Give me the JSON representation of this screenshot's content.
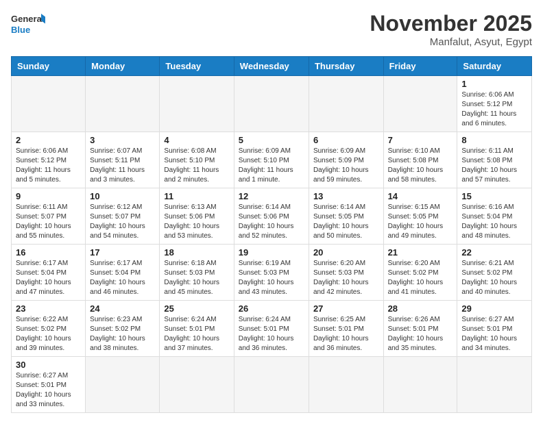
{
  "header": {
    "logo_general": "General",
    "logo_blue": "Blue",
    "month_year": "November 2025",
    "location": "Manfalut, Asyut, Egypt"
  },
  "weekdays": [
    "Sunday",
    "Monday",
    "Tuesday",
    "Wednesday",
    "Thursday",
    "Friday",
    "Saturday"
  ],
  "days": {
    "d1": {
      "num": "1",
      "sunrise": "6:06 AM",
      "sunset": "5:12 PM",
      "daylight": "11 hours and 6 minutes."
    },
    "d2": {
      "num": "2",
      "sunrise": "6:06 AM",
      "sunset": "5:12 PM",
      "daylight": "11 hours and 5 minutes."
    },
    "d3": {
      "num": "3",
      "sunrise": "6:07 AM",
      "sunset": "5:11 PM",
      "daylight": "11 hours and 3 minutes."
    },
    "d4": {
      "num": "4",
      "sunrise": "6:08 AM",
      "sunset": "5:10 PM",
      "daylight": "11 hours and 2 minutes."
    },
    "d5": {
      "num": "5",
      "sunrise": "6:09 AM",
      "sunset": "5:10 PM",
      "daylight": "11 hours and 1 minute."
    },
    "d6": {
      "num": "6",
      "sunrise": "6:09 AM",
      "sunset": "5:09 PM",
      "daylight": "10 hours and 59 minutes."
    },
    "d7": {
      "num": "7",
      "sunrise": "6:10 AM",
      "sunset": "5:08 PM",
      "daylight": "10 hours and 58 minutes."
    },
    "d8": {
      "num": "8",
      "sunrise": "6:11 AM",
      "sunset": "5:08 PM",
      "daylight": "10 hours and 57 minutes."
    },
    "d9": {
      "num": "9",
      "sunrise": "6:11 AM",
      "sunset": "5:07 PM",
      "daylight": "10 hours and 55 minutes."
    },
    "d10": {
      "num": "10",
      "sunrise": "6:12 AM",
      "sunset": "5:07 PM",
      "daylight": "10 hours and 54 minutes."
    },
    "d11": {
      "num": "11",
      "sunrise": "6:13 AM",
      "sunset": "5:06 PM",
      "daylight": "10 hours and 53 minutes."
    },
    "d12": {
      "num": "12",
      "sunrise": "6:14 AM",
      "sunset": "5:06 PM",
      "daylight": "10 hours and 52 minutes."
    },
    "d13": {
      "num": "13",
      "sunrise": "6:14 AM",
      "sunset": "5:05 PM",
      "daylight": "10 hours and 50 minutes."
    },
    "d14": {
      "num": "14",
      "sunrise": "6:15 AM",
      "sunset": "5:05 PM",
      "daylight": "10 hours and 49 minutes."
    },
    "d15": {
      "num": "15",
      "sunrise": "6:16 AM",
      "sunset": "5:04 PM",
      "daylight": "10 hours and 48 minutes."
    },
    "d16": {
      "num": "16",
      "sunrise": "6:17 AM",
      "sunset": "5:04 PM",
      "daylight": "10 hours and 47 minutes."
    },
    "d17": {
      "num": "17",
      "sunrise": "6:17 AM",
      "sunset": "5:04 PM",
      "daylight": "10 hours and 46 minutes."
    },
    "d18": {
      "num": "18",
      "sunrise": "6:18 AM",
      "sunset": "5:03 PM",
      "daylight": "10 hours and 45 minutes."
    },
    "d19": {
      "num": "19",
      "sunrise": "6:19 AM",
      "sunset": "5:03 PM",
      "daylight": "10 hours and 43 minutes."
    },
    "d20": {
      "num": "20",
      "sunrise": "6:20 AM",
      "sunset": "5:03 PM",
      "daylight": "10 hours and 42 minutes."
    },
    "d21": {
      "num": "21",
      "sunrise": "6:20 AM",
      "sunset": "5:02 PM",
      "daylight": "10 hours and 41 minutes."
    },
    "d22": {
      "num": "22",
      "sunrise": "6:21 AM",
      "sunset": "5:02 PM",
      "daylight": "10 hours and 40 minutes."
    },
    "d23": {
      "num": "23",
      "sunrise": "6:22 AM",
      "sunset": "5:02 PM",
      "daylight": "10 hours and 39 minutes."
    },
    "d24": {
      "num": "24",
      "sunrise": "6:23 AM",
      "sunset": "5:02 PM",
      "daylight": "10 hours and 38 minutes."
    },
    "d25": {
      "num": "25",
      "sunrise": "6:24 AM",
      "sunset": "5:01 PM",
      "daylight": "10 hours and 37 minutes."
    },
    "d26": {
      "num": "26",
      "sunrise": "6:24 AM",
      "sunset": "5:01 PM",
      "daylight": "10 hours and 36 minutes."
    },
    "d27": {
      "num": "27",
      "sunrise": "6:25 AM",
      "sunset": "5:01 PM",
      "daylight": "10 hours and 36 minutes."
    },
    "d28": {
      "num": "28",
      "sunrise": "6:26 AM",
      "sunset": "5:01 PM",
      "daylight": "10 hours and 35 minutes."
    },
    "d29": {
      "num": "29",
      "sunrise": "6:27 AM",
      "sunset": "5:01 PM",
      "daylight": "10 hours and 34 minutes."
    },
    "d30": {
      "num": "30",
      "sunrise": "6:27 AM",
      "sunset": "5:01 PM",
      "daylight": "10 hours and 33 minutes."
    }
  },
  "labels": {
    "sunrise_prefix": "Sunrise: ",
    "sunset_prefix": "Sunset: ",
    "daylight_prefix": "Daylight: "
  }
}
